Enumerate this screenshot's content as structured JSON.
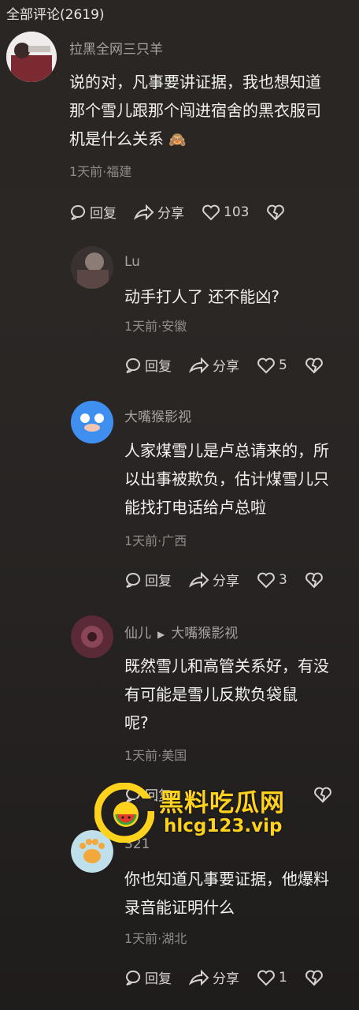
{
  "header": {
    "title": "全部评论(2619)"
  },
  "comments": [
    {
      "username": "拉黑全网三只羊",
      "text_lines": [
        "说的对，凡事要讲证据，我也想知道",
        "那个雪儿跟那个闯进宿舍的黑衣服司",
        "机是什么关系"
      ],
      "emoji": "🙈",
      "meta": "1天前·福建",
      "reply_label": "回复",
      "share_label": "分享",
      "like_count": "103"
    },
    {
      "username": "Lu",
      "text_lines": [
        "动手打人了 还不能凶?"
      ],
      "meta": "1天前·安徽",
      "reply_label": "回复",
      "share_label": "分享",
      "like_count": "5"
    },
    {
      "username": "大嘴猴影视",
      "text_lines": [
        "人家煤雪儿是卢总请来的，所",
        "以出事被欺负，估计煤雪儿只",
        "能找打电话给卢总啦"
      ],
      "meta": "1天前·广西",
      "reply_label": "回复",
      "share_label": "分享",
      "like_count": "3"
    },
    {
      "username": "仙儿",
      "reply_to": "大嘴猴影视",
      "text_lines": [
        "既然雪儿和高管关系好，有没",
        "有可能是雪儿反欺负袋鼠",
        "呢?"
      ],
      "meta": "1天前·美国",
      "reply_label": "回复"
    },
    {
      "username": "321",
      "text_lines": [
        "你也知道凡事要证据，他爆料",
        "录音能证明什么"
      ],
      "meta": "1天前·湖北",
      "reply_label": "回复",
      "share_label": "分享",
      "like_count": "1"
    }
  ],
  "watermark": {
    "title": "黑料吃瓜网",
    "url": "hlcg123.vip"
  },
  "colors": {
    "background": "#2a2623",
    "text": "#f3f1ee",
    "muted": "#8f8b87",
    "watermark": "#ffd21e"
  }
}
